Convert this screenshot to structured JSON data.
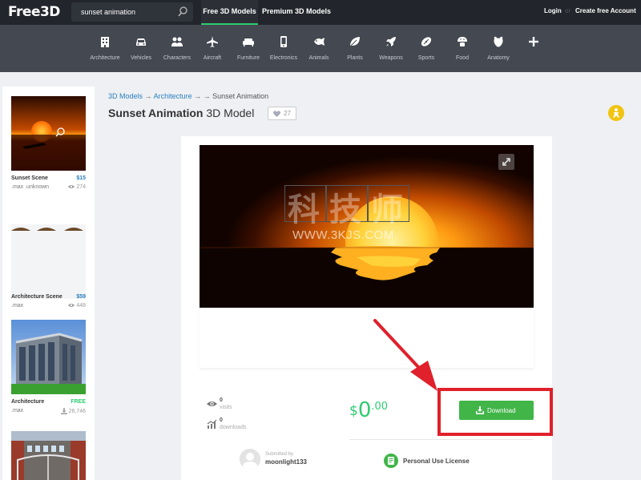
{
  "header": {
    "logo": "Free3D",
    "search": {
      "value": "sunset animation",
      "placeholder": ""
    },
    "tabs": [
      {
        "label": "Free 3D Models",
        "active": true
      },
      {
        "label": "Premium 3D Models",
        "active": false
      }
    ],
    "login": "Login",
    "separator": "or",
    "create_account": "Create free Account",
    "accent_color": "#2ecc71"
  },
  "categories": [
    {
      "label": "Architecture",
      "icon": "building-icon"
    },
    {
      "label": "Vehicles",
      "icon": "car-icon"
    },
    {
      "label": "Characters",
      "icon": "people-icon"
    },
    {
      "label": "Aircraft",
      "icon": "plane-icon"
    },
    {
      "label": "Furniture",
      "icon": "sofa-icon"
    },
    {
      "label": "Electronics",
      "icon": "phone-icon"
    },
    {
      "label": "Animals",
      "icon": "fish-icon"
    },
    {
      "label": "Plants",
      "icon": "leaf-icon"
    },
    {
      "label": "Weapons",
      "icon": "rocket-icon"
    },
    {
      "label": "Sports",
      "icon": "ball-icon"
    },
    {
      "label": "Food",
      "icon": "food-icon"
    },
    {
      "label": "Anatomy",
      "icon": "anatomy-icon"
    },
    {
      "label": "",
      "icon": "plus-icon"
    }
  ],
  "sidebar": {
    "items": [
      {
        "title": "Sunset Scene",
        "price": "$15",
        "format": ".max .unknown",
        "stat": "274",
        "stat_icon": "eye-icon"
      },
      {
        "title": "Architecture Scene",
        "price": "$59",
        "format": ".max",
        "stat": "448",
        "stat_icon": "eye-icon"
      },
      {
        "title": "Architecture",
        "price": "FREE",
        "format": ".max",
        "stat": "26,746",
        "stat_icon": "download-icon"
      }
    ]
  },
  "breadcrumb": {
    "items": [
      "3D Models",
      "Architecture"
    ],
    "separator": "→",
    "current": "Sunset Animation"
  },
  "model": {
    "title_bold": "Sunset Animation",
    "title_suffix": "3D Model",
    "likes": "27",
    "watermark_chars": [
      "科",
      "技",
      "师"
    ],
    "watermark_url": "WWW.3KJS.COM",
    "stats": [
      {
        "value": "0",
        "label": "visits",
        "icon": "eye-icon"
      },
      {
        "value": "0",
        "label": "downloads",
        "icon": "chart-icon"
      }
    ],
    "price": {
      "currency": "$",
      "integer": "0",
      "decimal": ".00"
    },
    "download_label": "Download",
    "submitted_label": "Submitted by",
    "submitter": "moonlight133",
    "license": "Personal Use License",
    "highlight_color": "#e0202b",
    "button_color": "#41b548"
  }
}
